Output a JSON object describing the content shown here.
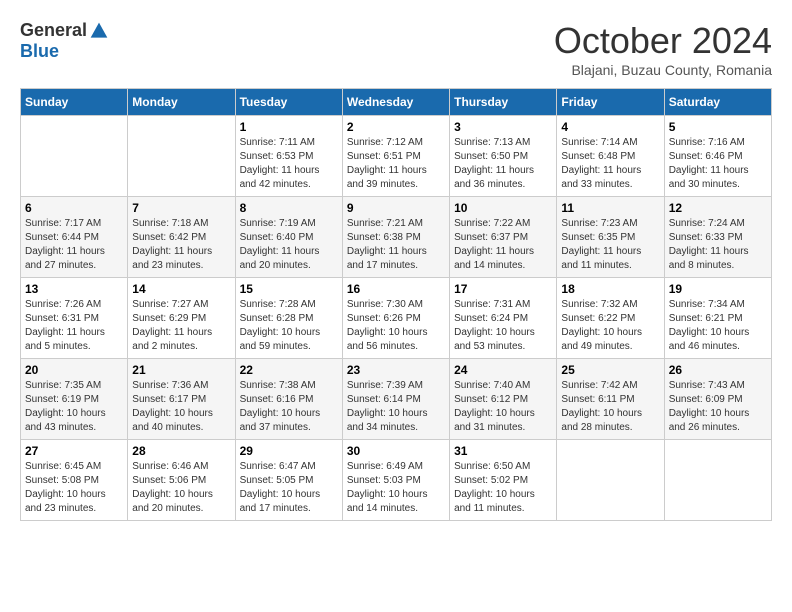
{
  "logo": {
    "general": "General",
    "blue": "Blue"
  },
  "title": "October 2024",
  "subtitle": "Blajani, Buzau County, Romania",
  "weekdays": [
    "Sunday",
    "Monday",
    "Tuesday",
    "Wednesday",
    "Thursday",
    "Friday",
    "Saturday"
  ],
  "weeks": [
    [
      {
        "day": "",
        "sunrise": "",
        "sunset": "",
        "daylight": ""
      },
      {
        "day": "",
        "sunrise": "",
        "sunset": "",
        "daylight": ""
      },
      {
        "day": "1",
        "sunrise": "Sunrise: 7:11 AM",
        "sunset": "Sunset: 6:53 PM",
        "daylight": "Daylight: 11 hours and 42 minutes."
      },
      {
        "day": "2",
        "sunrise": "Sunrise: 7:12 AM",
        "sunset": "Sunset: 6:51 PM",
        "daylight": "Daylight: 11 hours and 39 minutes."
      },
      {
        "day": "3",
        "sunrise": "Sunrise: 7:13 AM",
        "sunset": "Sunset: 6:50 PM",
        "daylight": "Daylight: 11 hours and 36 minutes."
      },
      {
        "day": "4",
        "sunrise": "Sunrise: 7:14 AM",
        "sunset": "Sunset: 6:48 PM",
        "daylight": "Daylight: 11 hours and 33 minutes."
      },
      {
        "day": "5",
        "sunrise": "Sunrise: 7:16 AM",
        "sunset": "Sunset: 6:46 PM",
        "daylight": "Daylight: 11 hours and 30 minutes."
      }
    ],
    [
      {
        "day": "6",
        "sunrise": "Sunrise: 7:17 AM",
        "sunset": "Sunset: 6:44 PM",
        "daylight": "Daylight: 11 hours and 27 minutes."
      },
      {
        "day": "7",
        "sunrise": "Sunrise: 7:18 AM",
        "sunset": "Sunset: 6:42 PM",
        "daylight": "Daylight: 11 hours and 23 minutes."
      },
      {
        "day": "8",
        "sunrise": "Sunrise: 7:19 AM",
        "sunset": "Sunset: 6:40 PM",
        "daylight": "Daylight: 11 hours and 20 minutes."
      },
      {
        "day": "9",
        "sunrise": "Sunrise: 7:21 AM",
        "sunset": "Sunset: 6:38 PM",
        "daylight": "Daylight: 11 hours and 17 minutes."
      },
      {
        "day": "10",
        "sunrise": "Sunrise: 7:22 AM",
        "sunset": "Sunset: 6:37 PM",
        "daylight": "Daylight: 11 hours and 14 minutes."
      },
      {
        "day": "11",
        "sunrise": "Sunrise: 7:23 AM",
        "sunset": "Sunset: 6:35 PM",
        "daylight": "Daylight: 11 hours and 11 minutes."
      },
      {
        "day": "12",
        "sunrise": "Sunrise: 7:24 AM",
        "sunset": "Sunset: 6:33 PM",
        "daylight": "Daylight: 11 hours and 8 minutes."
      }
    ],
    [
      {
        "day": "13",
        "sunrise": "Sunrise: 7:26 AM",
        "sunset": "Sunset: 6:31 PM",
        "daylight": "Daylight: 11 hours and 5 minutes."
      },
      {
        "day": "14",
        "sunrise": "Sunrise: 7:27 AM",
        "sunset": "Sunset: 6:29 PM",
        "daylight": "Daylight: 11 hours and 2 minutes."
      },
      {
        "day": "15",
        "sunrise": "Sunrise: 7:28 AM",
        "sunset": "Sunset: 6:28 PM",
        "daylight": "Daylight: 10 hours and 59 minutes."
      },
      {
        "day": "16",
        "sunrise": "Sunrise: 7:30 AM",
        "sunset": "Sunset: 6:26 PM",
        "daylight": "Daylight: 10 hours and 56 minutes."
      },
      {
        "day": "17",
        "sunrise": "Sunrise: 7:31 AM",
        "sunset": "Sunset: 6:24 PM",
        "daylight": "Daylight: 10 hours and 53 minutes."
      },
      {
        "day": "18",
        "sunrise": "Sunrise: 7:32 AM",
        "sunset": "Sunset: 6:22 PM",
        "daylight": "Daylight: 10 hours and 49 minutes."
      },
      {
        "day": "19",
        "sunrise": "Sunrise: 7:34 AM",
        "sunset": "Sunset: 6:21 PM",
        "daylight": "Daylight: 10 hours and 46 minutes."
      }
    ],
    [
      {
        "day": "20",
        "sunrise": "Sunrise: 7:35 AM",
        "sunset": "Sunset: 6:19 PM",
        "daylight": "Daylight: 10 hours and 43 minutes."
      },
      {
        "day": "21",
        "sunrise": "Sunrise: 7:36 AM",
        "sunset": "Sunset: 6:17 PM",
        "daylight": "Daylight: 10 hours and 40 minutes."
      },
      {
        "day": "22",
        "sunrise": "Sunrise: 7:38 AM",
        "sunset": "Sunset: 6:16 PM",
        "daylight": "Daylight: 10 hours and 37 minutes."
      },
      {
        "day": "23",
        "sunrise": "Sunrise: 7:39 AM",
        "sunset": "Sunset: 6:14 PM",
        "daylight": "Daylight: 10 hours and 34 minutes."
      },
      {
        "day": "24",
        "sunrise": "Sunrise: 7:40 AM",
        "sunset": "Sunset: 6:12 PM",
        "daylight": "Daylight: 10 hours and 31 minutes."
      },
      {
        "day": "25",
        "sunrise": "Sunrise: 7:42 AM",
        "sunset": "Sunset: 6:11 PM",
        "daylight": "Daylight: 10 hours and 28 minutes."
      },
      {
        "day": "26",
        "sunrise": "Sunrise: 7:43 AM",
        "sunset": "Sunset: 6:09 PM",
        "daylight": "Daylight: 10 hours and 26 minutes."
      }
    ],
    [
      {
        "day": "27",
        "sunrise": "Sunrise: 6:45 AM",
        "sunset": "Sunset: 5:08 PM",
        "daylight": "Daylight: 10 hours and 23 minutes."
      },
      {
        "day": "28",
        "sunrise": "Sunrise: 6:46 AM",
        "sunset": "Sunset: 5:06 PM",
        "daylight": "Daylight: 10 hours and 20 minutes."
      },
      {
        "day": "29",
        "sunrise": "Sunrise: 6:47 AM",
        "sunset": "Sunset: 5:05 PM",
        "daylight": "Daylight: 10 hours and 17 minutes."
      },
      {
        "day": "30",
        "sunrise": "Sunrise: 6:49 AM",
        "sunset": "Sunset: 5:03 PM",
        "daylight": "Daylight: 10 hours and 14 minutes."
      },
      {
        "day": "31",
        "sunrise": "Sunrise: 6:50 AM",
        "sunset": "Sunset: 5:02 PM",
        "daylight": "Daylight: 10 hours and 11 minutes."
      },
      {
        "day": "",
        "sunrise": "",
        "sunset": "",
        "daylight": ""
      },
      {
        "day": "",
        "sunrise": "",
        "sunset": "",
        "daylight": ""
      }
    ]
  ]
}
